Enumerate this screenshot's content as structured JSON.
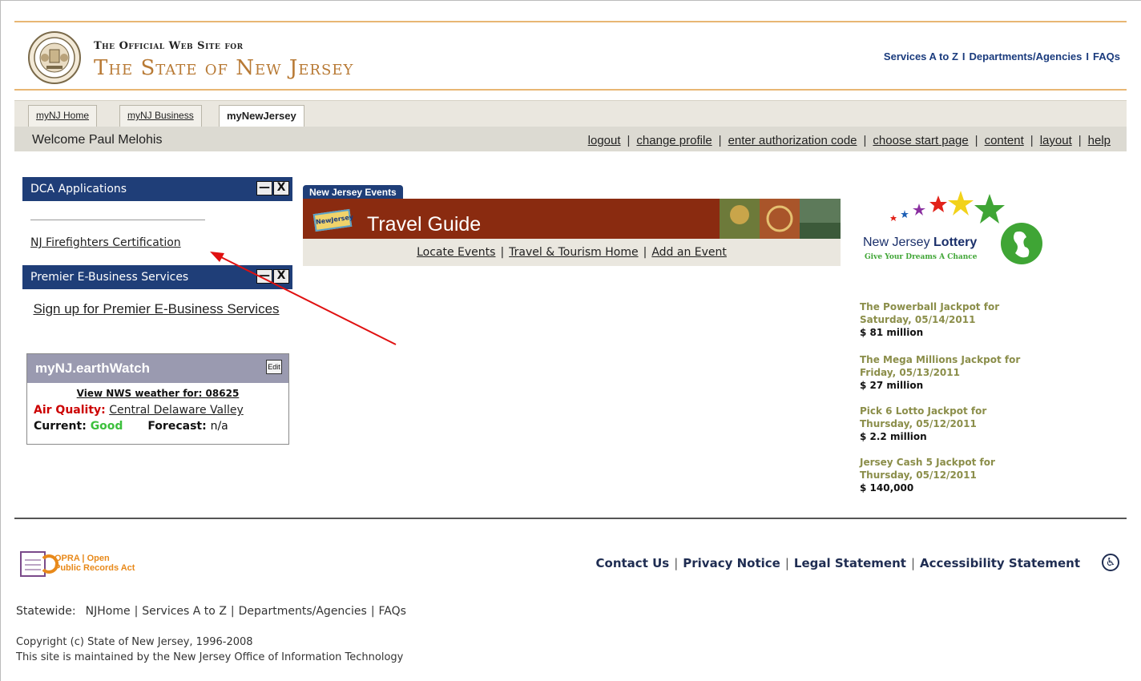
{
  "header": {
    "small_title": "The Official Web Site for",
    "big_title": "The State of New Jersey",
    "links": [
      "Services A to Z",
      "Departments/Agencies",
      "FAQs"
    ],
    "link_sep": "I"
  },
  "tabs": [
    {
      "label": "myNJ Home"
    },
    {
      "label": "myNJ Business"
    },
    {
      "label": "myNewJersey"
    }
  ],
  "welcome": "Welcome Paul Melohis",
  "user_links": [
    "logout",
    "change profile",
    "enter authorization code",
    "choose start page",
    "content",
    "layout",
    "help"
  ],
  "left": {
    "dca_title": "DCA Applications",
    "firefighters": "NJ Firefighters Certification",
    "premier_title": "Premier E-Business Services",
    "signup": "Sign up for Premier E-Business Services",
    "win_min": "—",
    "win_close": "X"
  },
  "earthwatch": {
    "title": "myNJ.earthWatch",
    "edit": "Edit",
    "nws": "View NWS weather for: 08625",
    "air_label": "Air Quality:",
    "air_value": "Central Delaware Valley",
    "current_label": "Current:",
    "current_value": "Good",
    "forecast_label": "Forecast:",
    "forecast_value": "n/a"
  },
  "travel": {
    "tab": "New Jersey Events",
    "title": "Travel Guide",
    "ticket": "NewJersey",
    "links": [
      "Locate Events",
      "Travel & Tourism Home",
      "Add an Event"
    ]
  },
  "lottery": {
    "brand": "New Jersey",
    "brand_bold": "Lottery",
    "tagline": "Give Your Dreams A Chance",
    "rows": [
      {
        "title": "The Powerball Jackpot for",
        "date": "Saturday, 05/14/2011",
        "value": "$ 81 million"
      },
      {
        "title": "The Mega Millions Jackpot for",
        "date": "Friday, 05/13/2011",
        "value": "$ 27 million"
      },
      {
        "title": "Pick 6 Lotto Jackpot for",
        "date": "Thursday, 05/12/2011",
        "value": "$ 2.2 million"
      },
      {
        "title": "Jersey Cash 5 Jackpot for",
        "date": "Thursday, 05/12/2011",
        "value": "$ 140,000"
      }
    ]
  },
  "footer": {
    "opra_line1": "OPRA | Open",
    "opra_line2": "Public Records Act",
    "links": [
      "Contact Us",
      "Privacy Notice",
      "Legal Statement",
      "Accessibility Statement"
    ],
    "statewide_label": "Statewide:",
    "statewide_links": [
      "NJHome",
      "Services A to Z",
      "Departments/Agencies",
      "FAQs"
    ],
    "copyright": "Copyright (c) State of New Jersey, 1996-2008",
    "maintained": "This site is maintained by the New Jersey Office of Information Technology"
  },
  "colors": {
    "nav_blue": "#1f3e78",
    "gold": "#b87a35",
    "lottery_olive": "#8b8e4a",
    "annotation_red": "#e01010"
  }
}
